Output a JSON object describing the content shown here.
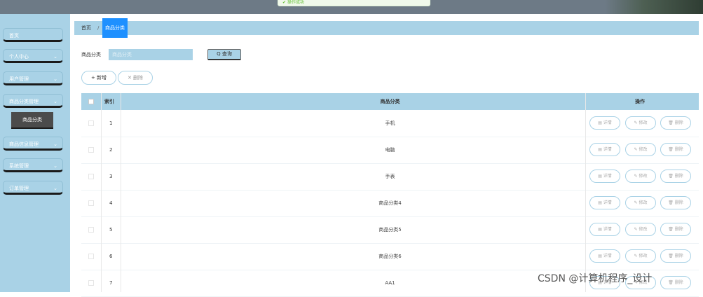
{
  "toast": {
    "text": "操作成功"
  },
  "sidebar": {
    "items": [
      {
        "label": "首页",
        "has_chevron": false
      },
      {
        "label": "个人中心",
        "has_chevron": true
      },
      {
        "label": "用户管理",
        "has_chevron": true
      },
      {
        "label": "商品分类管理",
        "has_chevron": true
      },
      {
        "label": "商品信息管理",
        "has_chevron": true
      },
      {
        "label": "系统管理",
        "has_chevron": true
      },
      {
        "label": "订单管理",
        "has_chevron": true
      }
    ],
    "submenu": {
      "label": "商品分类"
    },
    "chevron_glyph": "⌄"
  },
  "breadcrumb": {
    "home": "首页",
    "separator": "/",
    "current": "商品分类"
  },
  "search": {
    "label": "商品分类",
    "placeholder": "商品分类",
    "button": "Q 查询"
  },
  "actions": {
    "add": "+ 新增",
    "delete": "✕ 删除"
  },
  "table": {
    "headers": {
      "index": "索引",
      "category": "商品分类",
      "ops": "操作"
    },
    "rows": [
      {
        "index": "1",
        "name": "手机"
      },
      {
        "index": "2",
        "name": "电脑"
      },
      {
        "index": "3",
        "name": "手表"
      },
      {
        "index": "4",
        "name": "商品分类4"
      },
      {
        "index": "5",
        "name": "商品分类5"
      },
      {
        "index": "6",
        "name": "商品分类6"
      },
      {
        "index": "7",
        "name": "AA1"
      }
    ],
    "row_ops": {
      "detail": "▤ 详情",
      "edit": "✎ 修改",
      "delete": "🗑 删除"
    }
  },
  "watermark": "CSDN @计算机程序_设计",
  "colors": {
    "accent": "#a9d2e6",
    "active": "#1e90ff",
    "sub_active": "#4b4b4b"
  }
}
